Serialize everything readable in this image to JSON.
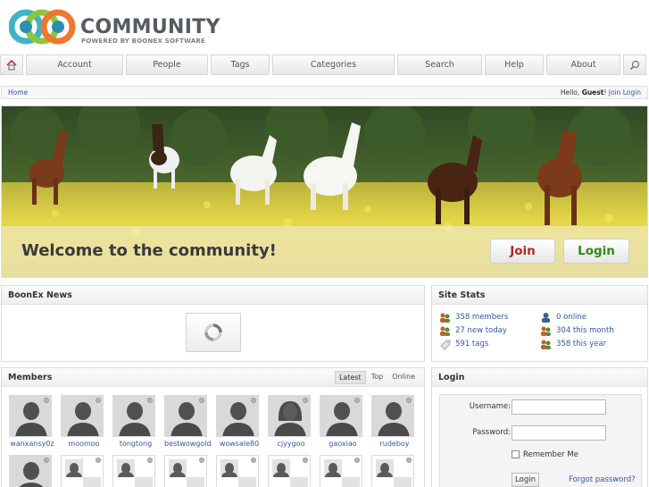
{
  "header": {
    "logo_title": "COMMUNITY",
    "logo_subtitle": "POWERED BY BOONEX SOFTWARE"
  },
  "nav": {
    "home_icon": "home-icon",
    "items": [
      "Account",
      "People",
      "Tags",
      "Categories",
      "Search",
      "Help",
      "About"
    ],
    "search_icon": "magnifier-icon"
  },
  "breadcrumb": {
    "home": "Home",
    "hello_prefix": "Hello,",
    "guest": "Guest",
    "hello_suffix": "!",
    "join": "Join",
    "login": "Login"
  },
  "hero": {
    "welcome": "Welcome to the community!",
    "join_label": "Join",
    "login_label": "Login"
  },
  "news": {
    "title": "BoonEx News"
  },
  "stats": {
    "title": "Site Stats",
    "items": [
      {
        "text": "358 members",
        "icon": "members-icon"
      },
      {
        "text": "0 online",
        "icon": "online-icon"
      },
      {
        "text": "27 new today",
        "icon": "new-members-icon"
      },
      {
        "text": "304 this month",
        "icon": "month-members-icon"
      },
      {
        "text": "591 tags",
        "icon": "tag-icon"
      },
      {
        "text": "358 this year",
        "icon": "year-members-icon"
      }
    ]
  },
  "members": {
    "title": "Members",
    "tabs": [
      "Latest",
      "Top",
      "Online"
    ],
    "active_tab": "Latest",
    "list": [
      {
        "name": "wanxansy0z",
        "avatar": "male"
      },
      {
        "name": "moomoo",
        "avatar": "male"
      },
      {
        "name": "tongtong",
        "avatar": "male"
      },
      {
        "name": "bestwowgold",
        "avatar": "male"
      },
      {
        "name": "wowsale80",
        "avatar": "male"
      },
      {
        "name": "cjyygoo",
        "avatar": "female"
      },
      {
        "name": "gaoxiao",
        "avatar": "male"
      },
      {
        "name": "rudeboy",
        "avatar": "male"
      }
    ]
  },
  "login": {
    "title": "Login",
    "username_label": "Username:",
    "password_label": "Password:",
    "remember_label": "Remember Me",
    "submit_label": "Login",
    "forgot_label": "Forgot password?"
  },
  "colors": {
    "link": "#3355aa",
    "join": "#b8281d",
    "login": "#2f8a17",
    "logo_text": "#555b61"
  }
}
